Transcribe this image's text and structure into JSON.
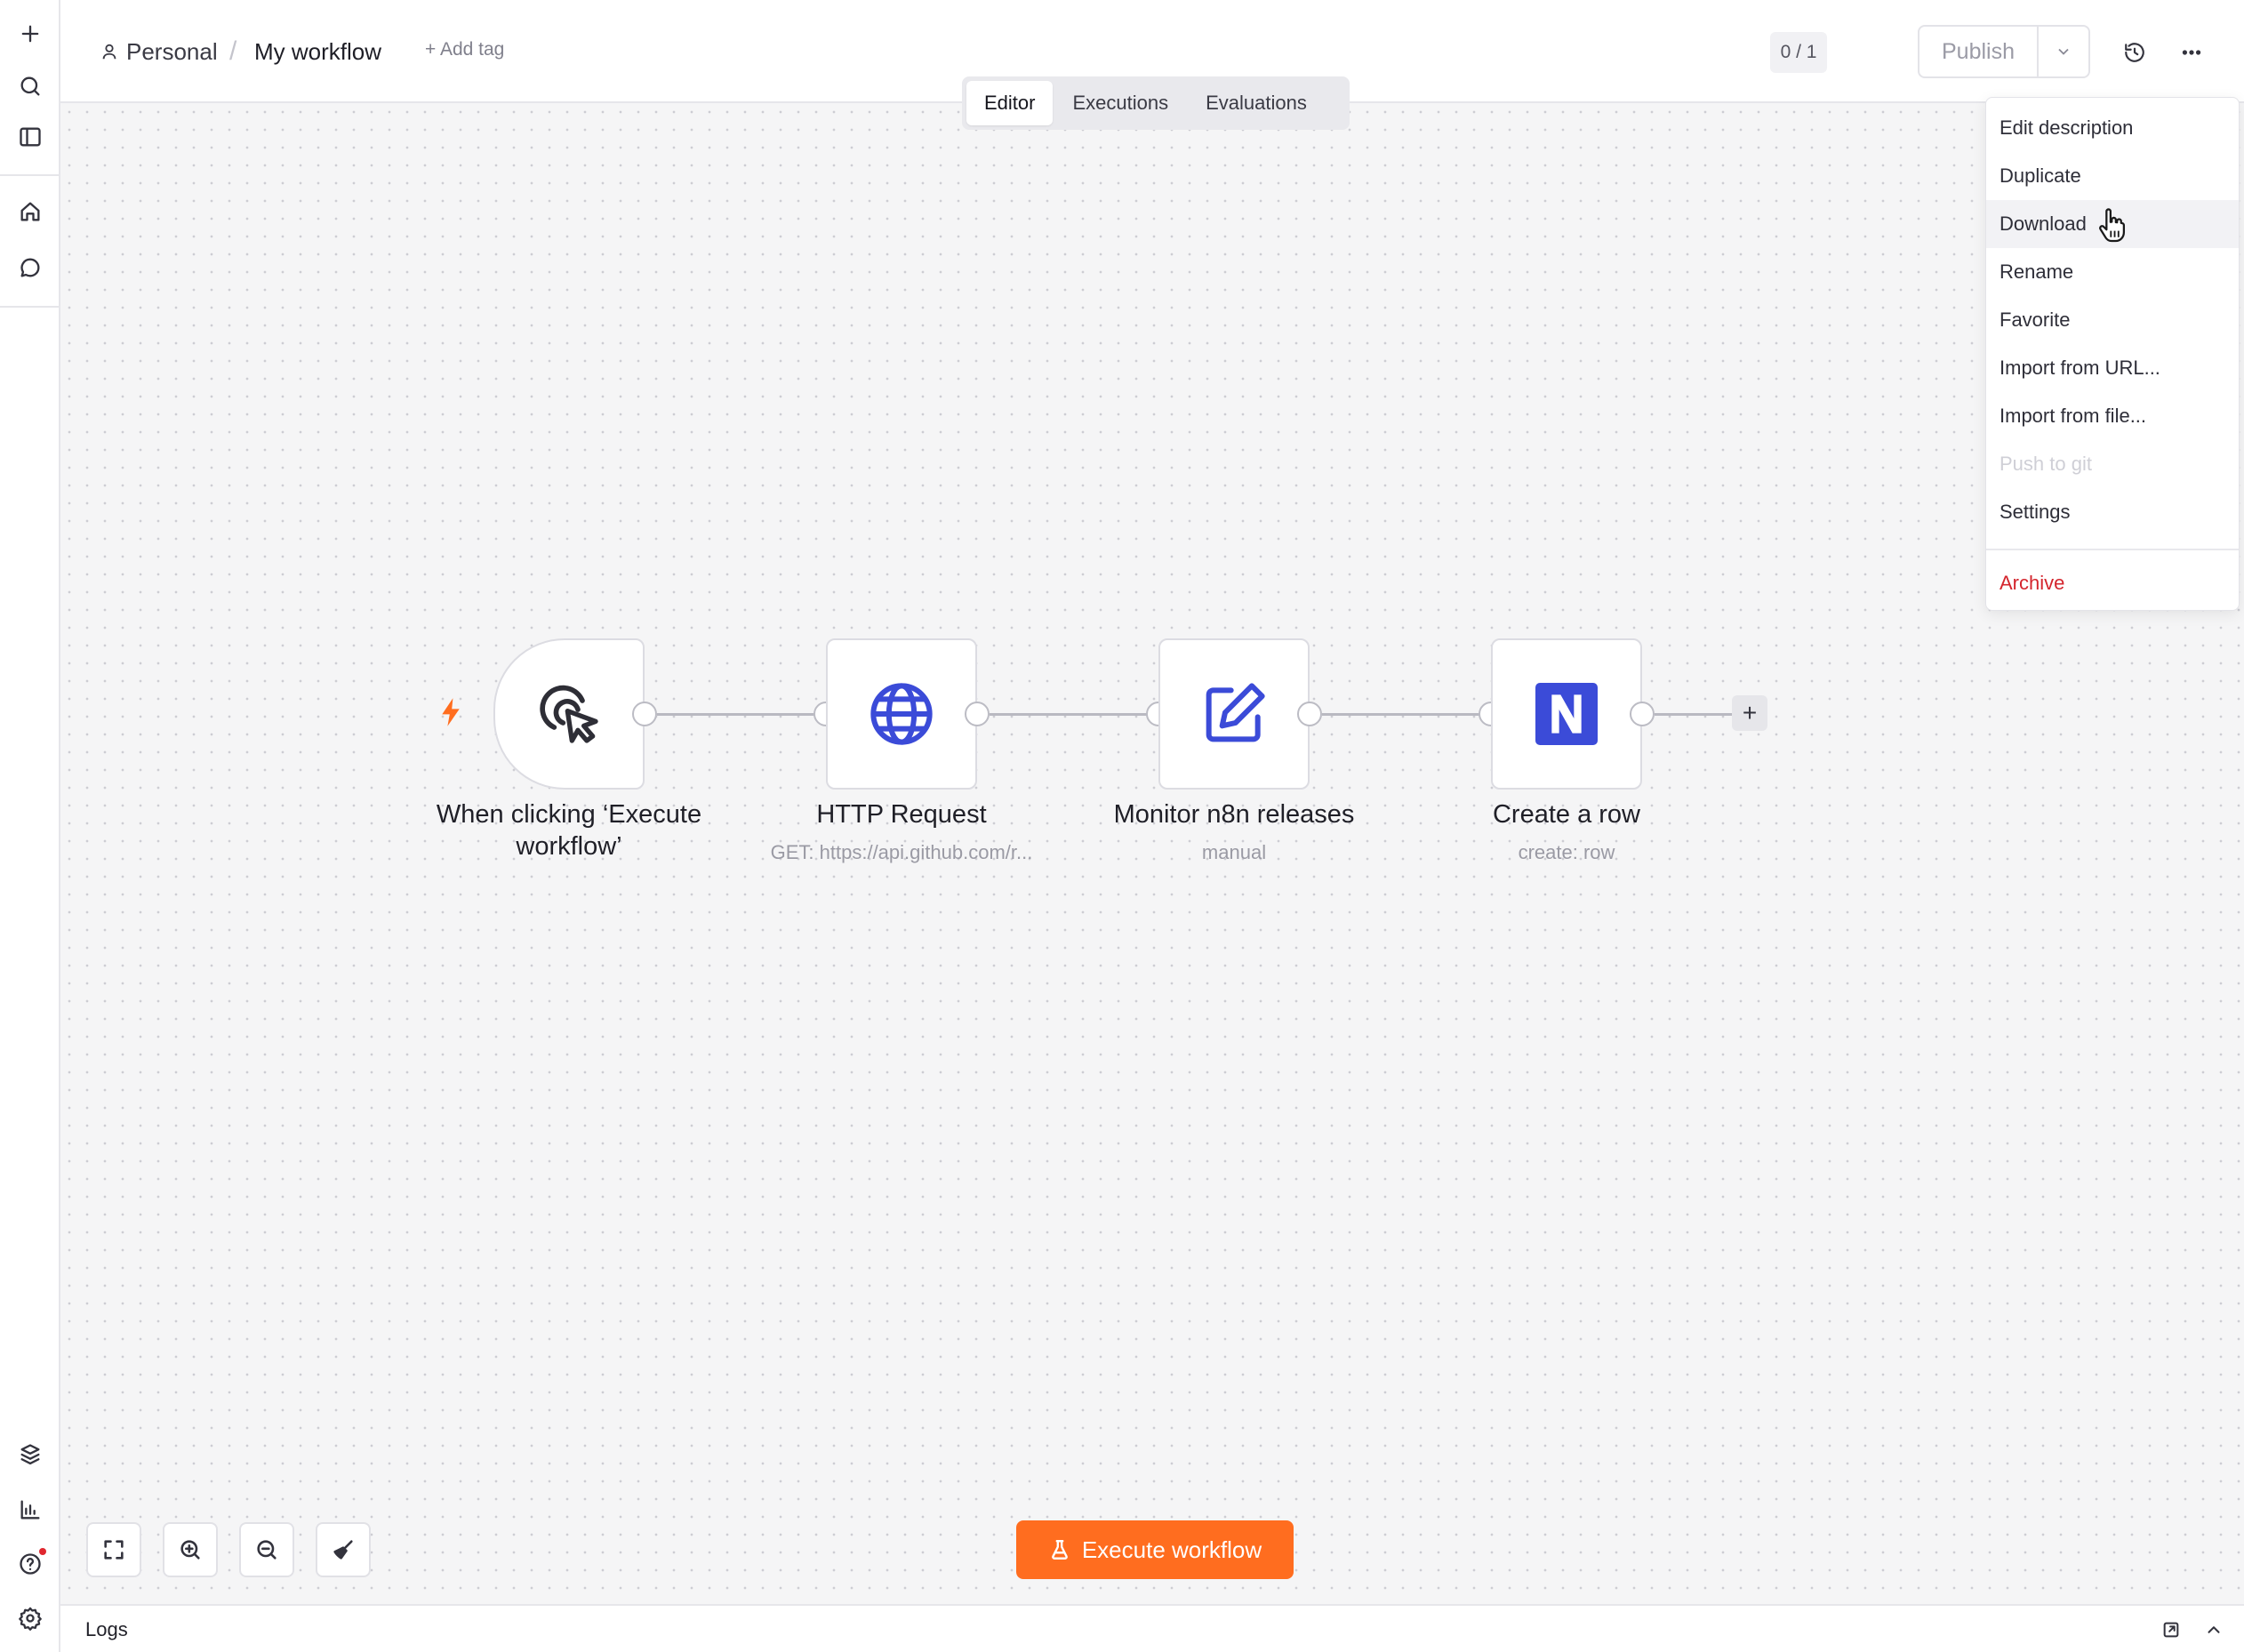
{
  "breadcrumb": {
    "project": "Personal",
    "workflow_title": "My workflow",
    "add_tag": "+ Add tag"
  },
  "header": {
    "counter": "0 / 1",
    "publish_label": "Publish"
  },
  "tabs": [
    {
      "label": "Editor",
      "active": true
    },
    {
      "label": "Executions",
      "active": false
    },
    {
      "label": "Evaluations",
      "active": false
    }
  ],
  "nodes": [
    {
      "title": "When clicking ‘Execute workflow’",
      "subtitle": "",
      "icon": "cursor-click-icon"
    },
    {
      "title": "HTTP Request",
      "subtitle": "GET: https://api.github.com/r...",
      "icon": "globe-icon"
    },
    {
      "title": "Monitor n8n releases",
      "subtitle": "manual",
      "icon": "edit-icon"
    },
    {
      "title": "Create a row",
      "subtitle": "create: row",
      "icon": "notion-icon"
    }
  ],
  "add_node_symbol": "+",
  "execute_button": "Execute workflow",
  "logs": {
    "label": "Logs"
  },
  "menu": {
    "items": [
      {
        "label": "Edit description",
        "state": "normal"
      },
      {
        "label": "Duplicate",
        "state": "normal"
      },
      {
        "label": "Download",
        "state": "hover"
      },
      {
        "label": "Rename",
        "state": "normal"
      },
      {
        "label": "Favorite",
        "state": "normal"
      },
      {
        "label": "Import from URL...",
        "state": "normal"
      },
      {
        "label": "Import from file...",
        "state": "normal"
      },
      {
        "label": "Push to git",
        "state": "disabled"
      },
      {
        "label": "Settings",
        "state": "normal"
      }
    ],
    "archive_label": "Archive"
  },
  "colors": {
    "accent": "#ff6d1f",
    "node_icon_blue": "#3b4bd8",
    "danger": "#d4252d"
  }
}
